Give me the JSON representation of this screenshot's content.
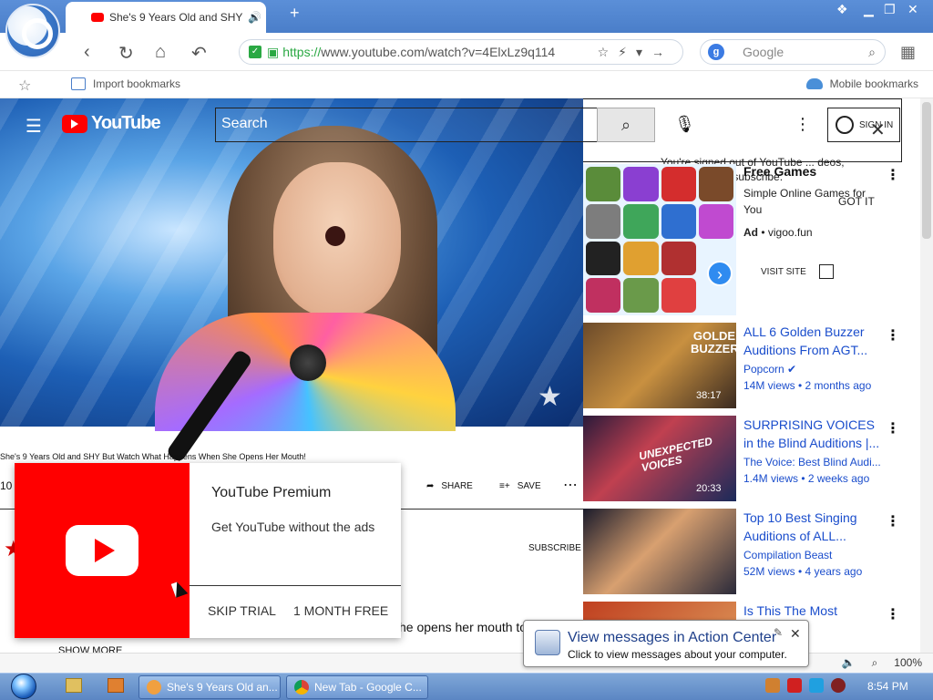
{
  "browser": {
    "tab_title": "She's 9 Years Old and SHY",
    "new_tab_symbol": "+",
    "url_scheme": "https://",
    "url_rest": "www.youtube.com/watch?v=4ElxLz9q114",
    "search_placeholder": "Google",
    "bookmarks": {
      "import_label": "Import bookmarks",
      "mobile_label": "Mobile bookmarks"
    },
    "zoom": "100%"
  },
  "youtube": {
    "logo_text": "YouTube",
    "search_placeholder": "Search",
    "sign_in": "SIGN IN",
    "signed_out_text": "You're signed out of YouTube ... deos, comment, and subscribe.",
    "got_it": "GOT IT",
    "video_title": "She's 9 Years Old and SHY But Watch What Happens When She Opens Her Mouth!",
    "view_count_partial": "10",
    "share_label": "SHARE",
    "save_label": "SAVE",
    "subscribe_label": "SUBSCRIBE",
    "description_partial": "he opens her mouth to",
    "show_more": "SHOW MORE",
    "premium": {
      "title": "YouTube Premium",
      "subtitle": "Get YouTube without the ads",
      "skip": "SKIP TRIAL",
      "free": "1 MONTH FREE"
    },
    "ad": {
      "title": "Free Games",
      "desc": "Simple Online Games for You",
      "label": "Ad",
      "domain": "vigoo.fun",
      "visit": "VISIT SITE"
    },
    "sidebar": [
      {
        "title": "ALL 6 Golden Buzzer Auditions From AGT...",
        "channel": "Popcorn",
        "meta": "14M views • 2 months ago",
        "duration": "38:17"
      },
      {
        "title": "SURPRISING VOICES in the Blind Auditions |...",
        "channel": "The Voice: Best Blind Audi...",
        "meta": "1.4M views • 2 weeks ago",
        "duration": "20:33"
      },
      {
        "title": "Top 10 Best Singing Auditions of ALL...",
        "channel": "Compilation Beast",
        "meta": "52M views • 4 years ago",
        "duration": "..."
      },
      {
        "title": "Is This The Most ...male...",
        "channel": "",
        "meta": "",
        "duration": ""
      }
    ]
  },
  "notification": {
    "title": "View messages in Action Center",
    "subtitle": "Click to view messages about your computer."
  },
  "taskbar": {
    "task1": "She's 9 Years Old an...",
    "task2": "New Tab - Google C...",
    "clock": "8:54 PM"
  },
  "colors": {
    "accent": "#1a4dcc",
    "youtube_red": "#ff0000"
  }
}
